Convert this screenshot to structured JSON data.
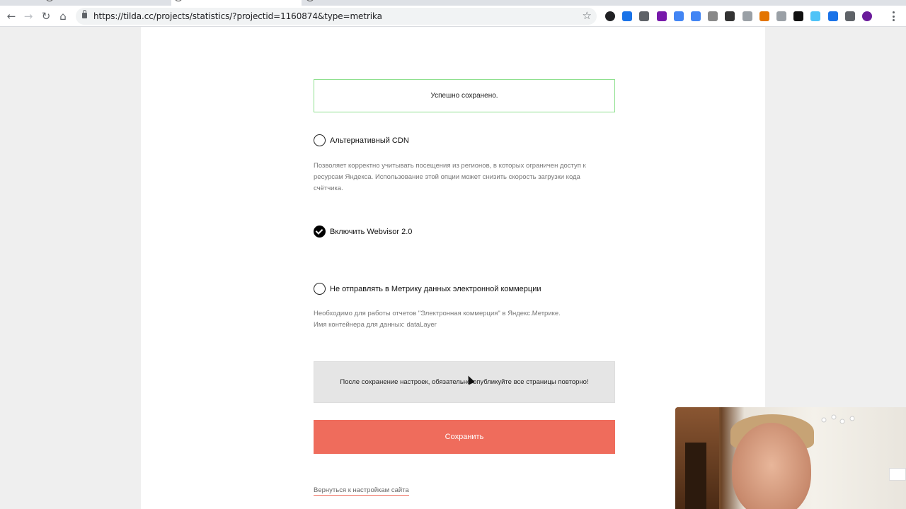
{
  "browser": {
    "url": "https://tilda.cc/projects/statistics/?projectid=1160874&type=metrika",
    "icons": [
      "back-icon",
      "forward-icon",
      "reload-icon",
      "home-icon",
      "lock-icon",
      "star-icon",
      "menu-icon"
    ],
    "extensions": [
      {
        "name": "ext-dark-circle-icon",
        "color": "#202124"
      },
      {
        "name": "ext-bird-icon",
        "color": "#1a73e8"
      },
      {
        "name": "ext-pencil-icon",
        "color": "#5f6368"
      },
      {
        "name": "ext-onenote-icon",
        "color": "#7719aa"
      },
      {
        "name": "ext-translate-icon",
        "color": "#4285f4"
      },
      {
        "name": "ext-window-icon",
        "color": "#4285f4"
      },
      {
        "name": "ext-book-icon",
        "color": "#888888"
      },
      {
        "name": "ext-shield-icon",
        "color": "#333333"
      },
      {
        "name": "ext-cloud-icon",
        "color": "#9aa0a6"
      },
      {
        "name": "ext-colorball-icon",
        "color": "#e37400"
      },
      {
        "name": "ext-code-icon",
        "color": "#9aa0a6"
      },
      {
        "name": "ext-cursor-icon",
        "color": "#111111"
      },
      {
        "name": "ext-edit-icon",
        "color": "#4fc3f7"
      },
      {
        "name": "ext-new-icon",
        "color": "#1a73e8"
      },
      {
        "name": "ext-camera-icon",
        "color": "#5f6368"
      },
      {
        "name": "ext-avatar-icon",
        "color": "#6a1b9a"
      }
    ]
  },
  "page": {
    "success_message": "Успешно сохранено.",
    "options": [
      {
        "label": "Альтернативный CDN",
        "checked": false,
        "description": "Позволяет корректно учитывать посещения из регионов, в которых ограничен доступ к ресурсам Яндекса. Использование этой опции может снизить скорость загрузки кода счётчика."
      },
      {
        "label": "Включить Webvisor 2.0",
        "checked": true
      },
      {
        "label": "Не отправлять в Метрику данных электронной коммерции",
        "checked": false,
        "description_line1": "Необходимо для работы отчетов \"Электронная коммерция\" в Яндекс.Метрике.",
        "description_line2": "Имя контейнера для данных: dataLayer"
      }
    ],
    "notice": "После сохранение настроек, обязательно опубликуйте все страницы повторно!",
    "save_button": "Сохранить",
    "back_link": "Вернуться к настройкам сайта"
  },
  "colors": {
    "accent": "#ef6c5c",
    "success_border": "#8ee08e"
  }
}
